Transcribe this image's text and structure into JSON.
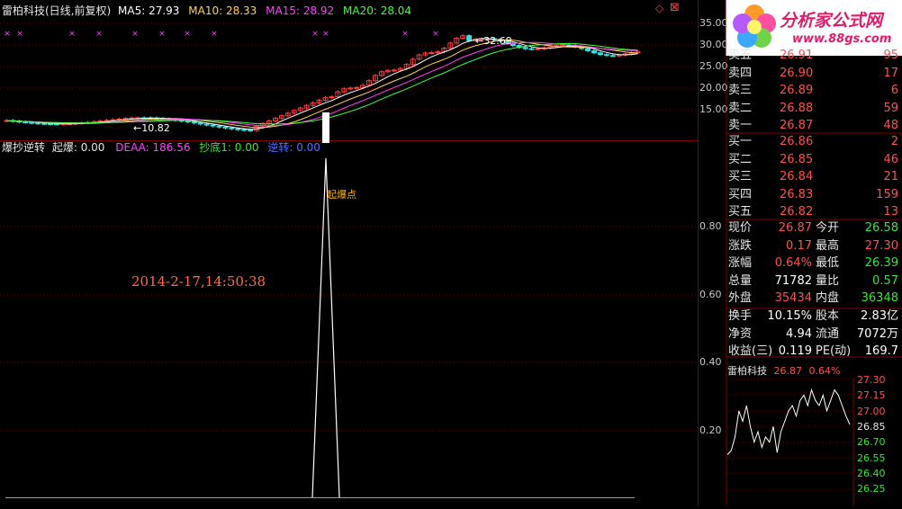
{
  "colors": {
    "bg": "#000000",
    "grid": "#7a0000",
    "up": "#ff3c3c",
    "down": "#35e0e0",
    "ma5": "#ffffff",
    "ma10": "#ffd257",
    "ma15": "#ff40ff",
    "ma20": "#40ff40",
    "red": "#ff5050",
    "green": "#35e835",
    "deaa": "#ff40ff",
    "chaodi": "#35e835",
    "nizhuan": "#5070ff"
  },
  "main_header": {
    "title": "雷柏科技(日线,前复权)",
    "ma5_label": "MA5: 27.93",
    "ma10_label": "MA10: 28.33",
    "ma15_label": "MA15: 28.92",
    "ma20_label": "MA20: 28.04"
  },
  "main_axis": [
    "35.00",
    "30.00",
    "25.00",
    "20.00",
    "15.00"
  ],
  "main_annotations": {
    "high": "32.69",
    "low": "10.82"
  },
  "sub_header": {
    "name": "爆抄逆转",
    "qibao": "起爆: 0.00",
    "deaa": "DEAA: 186.56",
    "chaodi": "抄底1: 0.00",
    "nizhuan": "逆转: 0.00"
  },
  "sub_axis": [
    "0.80",
    "0.60",
    "0.40",
    "0.20"
  ],
  "sub_annotation": "起爆点",
  "datetime": "2014-2-17,14:50:38",
  "window_icons": {
    "diamond": "◇",
    "close": "⊠"
  },
  "logo": {
    "text": "分析家公式网",
    "url": "www.88gs.com"
  },
  "orderbook": {
    "sell": [
      {
        "label": "卖五",
        "price": "26.91",
        "vol": "95"
      },
      {
        "label": "卖四",
        "price": "26.90",
        "vol": "17"
      },
      {
        "label": "卖三",
        "price": "26.89",
        "vol": "6"
      },
      {
        "label": "卖二",
        "price": "26.88",
        "vol": "59"
      },
      {
        "label": "卖一",
        "price": "26.87",
        "vol": "48"
      }
    ],
    "buy": [
      {
        "label": "买一",
        "price": "26.86",
        "vol": "2"
      },
      {
        "label": "买二",
        "price": "26.85",
        "vol": "46"
      },
      {
        "label": "买三",
        "price": "26.84",
        "vol": "21"
      },
      {
        "label": "买四",
        "price": "26.83",
        "vol": "159"
      },
      {
        "label": "买五",
        "price": "26.82",
        "vol": "13"
      }
    ]
  },
  "quote": [
    {
      "l1": "现价",
      "v1": "26.87",
      "c1": "red",
      "l2": "今开",
      "v2": "26.58",
      "c2": "green"
    },
    {
      "l1": "涨跌",
      "v1": "0.17",
      "c1": "red",
      "l2": "最高",
      "v2": "27.30",
      "c2": "red"
    },
    {
      "l1": "涨幅",
      "v1": "0.64%",
      "c1": "red",
      "l2": "最低",
      "v2": "26.39",
      "c2": "green"
    },
    {
      "l1": "总量",
      "v1": "71782",
      "c1": "white",
      "l2": "量比",
      "v2": "0.57",
      "c2": "green"
    },
    {
      "l1": "外盘",
      "v1": "35434",
      "c1": "red",
      "l2": "内盘",
      "v2": "36348",
      "c2": "green"
    }
  ],
  "stats": [
    {
      "l1": "换手",
      "v1": "10.15%",
      "l2": "股本",
      "v2": "2.83亿"
    },
    {
      "l1": "净资",
      "v1": "4.94",
      "l2": "流通",
      "v2": "7072万"
    },
    {
      "l1": "收益(三)",
      "v1": "0.119",
      "l2": "PE(动)",
      "v2": "169.7"
    }
  ],
  "mini": {
    "name": "雷柏科技",
    "price": "26.87",
    "pct": "0.64%",
    "axis": [
      "27.30",
      "27.15",
      "27.00",
      "26.85",
      "26.70",
      "26.55",
      "26.40",
      "26.25"
    ]
  }
}
